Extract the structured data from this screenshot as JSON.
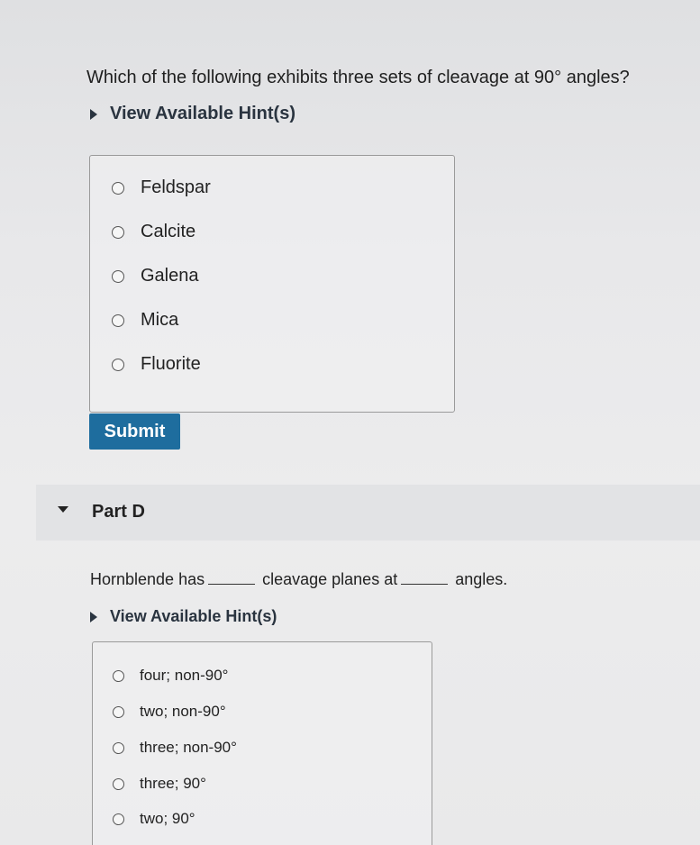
{
  "part_c": {
    "question": "Which of the following exhibits three sets of cleavage at 90° angles?",
    "hint_label": "View Available Hint(s)",
    "options": [
      "Feldspar",
      "Calcite",
      "Galena",
      "Mica",
      "Fluorite"
    ],
    "submit_label": "Submit"
  },
  "part_d": {
    "title": "Part D",
    "statement": {
      "seg1": "Hornblende has",
      "seg2": "cleavage planes at",
      "seg3": "angles."
    },
    "hint_label": "View Available Hint(s)",
    "options": [
      "four; non-90°",
      "two; non-90°",
      "three; non-90°",
      "three; 90°",
      "two; 90°"
    ]
  }
}
